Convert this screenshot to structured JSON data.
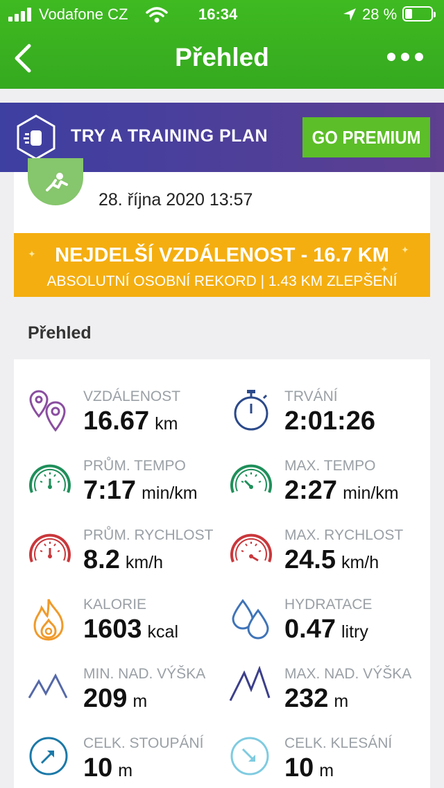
{
  "status_bar": {
    "carrier": "Vodafone CZ",
    "time": "16:34",
    "battery_percent": "28 %"
  },
  "header": {
    "title": "Přehled",
    "back_icon": "chevron-left-icon",
    "menu_icon": "more-dots-icon"
  },
  "promo": {
    "text": "TRY A TRAINING PLAN",
    "button_label": "GO PREMIUM",
    "icon": "plan-badge-icon"
  },
  "activity": {
    "datetime": "28. října 2020 13:57",
    "icon": "runner-icon"
  },
  "record": {
    "title": "NEJDELŠÍ VZDÁLENOST - 16.7 KM",
    "subtitle": "ABSOLUTNÍ OSOBNÍ REKORD  |  1.43 KM ZLEPŠENÍ"
  },
  "overview": {
    "section_title": "Přehled",
    "stats": [
      {
        "label": "VZDÁLENOST",
        "value": "16.67",
        "unit": "km",
        "icon": "location-pins-icon"
      },
      {
        "label": "TRVÁNÍ",
        "value": "2:01:26",
        "unit": "",
        "icon": "stopwatch-icon"
      },
      {
        "label": "PRŮM. TEMPO",
        "value": "7:17",
        "unit": "min/km",
        "icon": "gauge-icon"
      },
      {
        "label": "MAX. TEMPO",
        "value": "2:27",
        "unit": "min/km",
        "icon": "gauge-icon"
      },
      {
        "label": "PRŮM. RYCHLOST",
        "value": "8.2",
        "unit": "km/h",
        "icon": "speedometer-icon"
      },
      {
        "label": "MAX. RYCHLOST",
        "value": "24.5",
        "unit": "km/h",
        "icon": "speedometer-icon"
      },
      {
        "label": "KALORIE",
        "value": "1603",
        "unit": "kcal",
        "icon": "flame-icon"
      },
      {
        "label": "HYDRATACE",
        "value": "0.47",
        "unit": "litry",
        "icon": "drops-icon"
      },
      {
        "label": "MIN. NAD. VÝŠKA",
        "value": "209",
        "unit": "m",
        "icon": "mountain-low-icon"
      },
      {
        "label": "MAX. NAD. VÝŠKA",
        "value": "232",
        "unit": "m",
        "icon": "mountain-high-icon"
      },
      {
        "label": "CELK. STOUPÁNÍ",
        "value": "10",
        "unit": "m",
        "icon": "ascent-arrow-icon"
      },
      {
        "label": "CELK. KLESÁNÍ",
        "value": "10",
        "unit": "m",
        "icon": "descent-arrow-icon"
      }
    ]
  },
  "colors": {
    "header_green": "#3fba21",
    "premium_green": "#5cbe28",
    "record_orange": "#f4ae10",
    "promo_purple": "#4b3f9b"
  }
}
